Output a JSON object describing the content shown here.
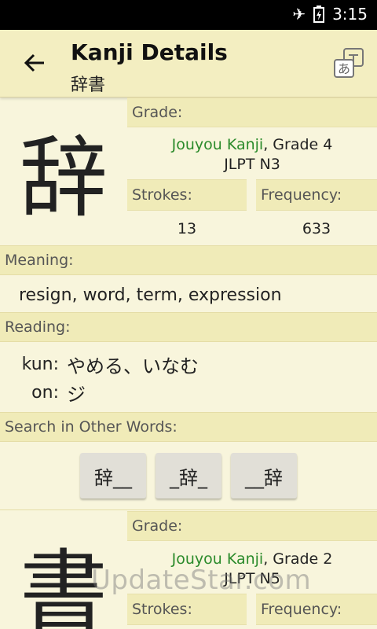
{
  "status_bar": {
    "time": "3:15",
    "icons": [
      "airplane-icon",
      "battery-charging-icon"
    ]
  },
  "app_bar": {
    "title": "Kanji Details",
    "subtitle": "辞書",
    "back_icon": "arrow-left-icon",
    "action_icon": "translate-icon"
  },
  "kanji_entries": [
    {
      "kanji": "辞",
      "grade_header": "Grade:",
      "grade_prefix": "Jouyou Kanji",
      "grade_suffix": ", Grade 4",
      "jlpt": "JLPT N3",
      "strokes_label": "Strokes:",
      "strokes": "13",
      "frequency_label": "Frequency:",
      "frequency": "633"
    },
    {
      "kanji": "書",
      "grade_header": "Grade:",
      "grade_prefix": "Jouyou Kanji",
      "grade_suffix": ", Grade 2",
      "jlpt": "JLPT N5",
      "strokes_label": "Strokes:",
      "frequency_label": "Frequency:"
    }
  ],
  "meaning": {
    "label": "Meaning:",
    "text": "resign, word, term, expression"
  },
  "reading": {
    "label": "Reading:",
    "kun_label": "kun:",
    "kun_value": "やめる、いなむ",
    "on_label": "on:",
    "on_value": "ジ"
  },
  "search": {
    "label": "Search in Other Words:",
    "buttons": [
      "辞__",
      "_辞_",
      "__辞"
    ]
  },
  "watermark": "UpdateStar.com",
  "colors": {
    "background": "#f8f5dc",
    "header": "#f0ebb8",
    "link_green": "#2a8a2a",
    "button": "#e1dfd7"
  }
}
